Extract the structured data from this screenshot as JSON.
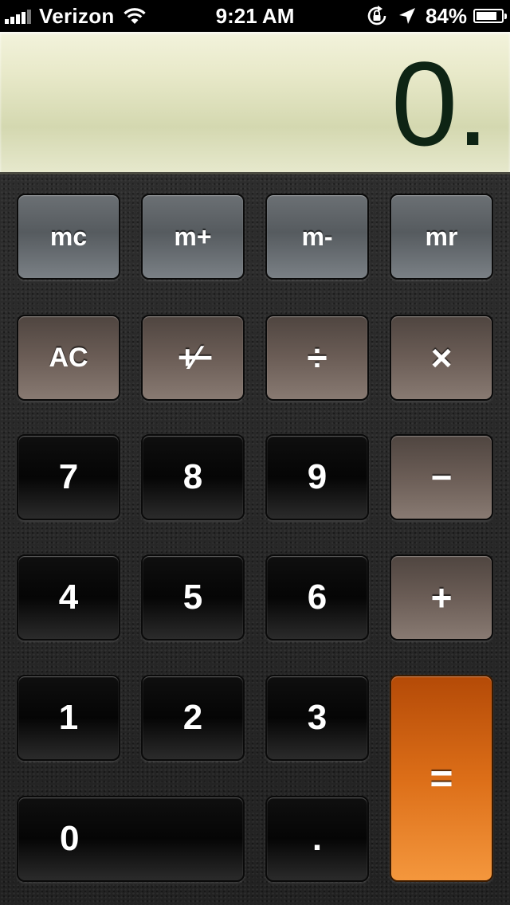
{
  "status_bar": {
    "carrier": "Verizon",
    "time": "9:21 AM",
    "battery_percent": "84%",
    "battery_level": 0.84,
    "signal_bars": 4
  },
  "display": {
    "value": "0."
  },
  "keys": {
    "mc": "mc",
    "m_plus": "m+",
    "m_minus": "m-",
    "mr": "mr",
    "ac": "AC",
    "plus_minus": "+⁄−",
    "divide": "÷",
    "multiply": "×",
    "seven": "7",
    "eight": "8",
    "nine": "9",
    "minus": "−",
    "four": "4",
    "five": "5",
    "six": "6",
    "plus": "+",
    "one": "1",
    "two": "2",
    "three": "3",
    "equals": "=",
    "zero": "0",
    "decimal": "."
  },
  "icons": {
    "wifi": "wifi-icon",
    "rotation_lock": "rotation-lock-icon",
    "location": "location-arrow-icon",
    "battery": "battery-icon"
  },
  "colors": {
    "display_text": "#0e2414",
    "equals_key": "#dc6e18",
    "memory_key": "#60666a",
    "operator_key": "#6b5d56",
    "number_key": "#0a0a0a"
  }
}
